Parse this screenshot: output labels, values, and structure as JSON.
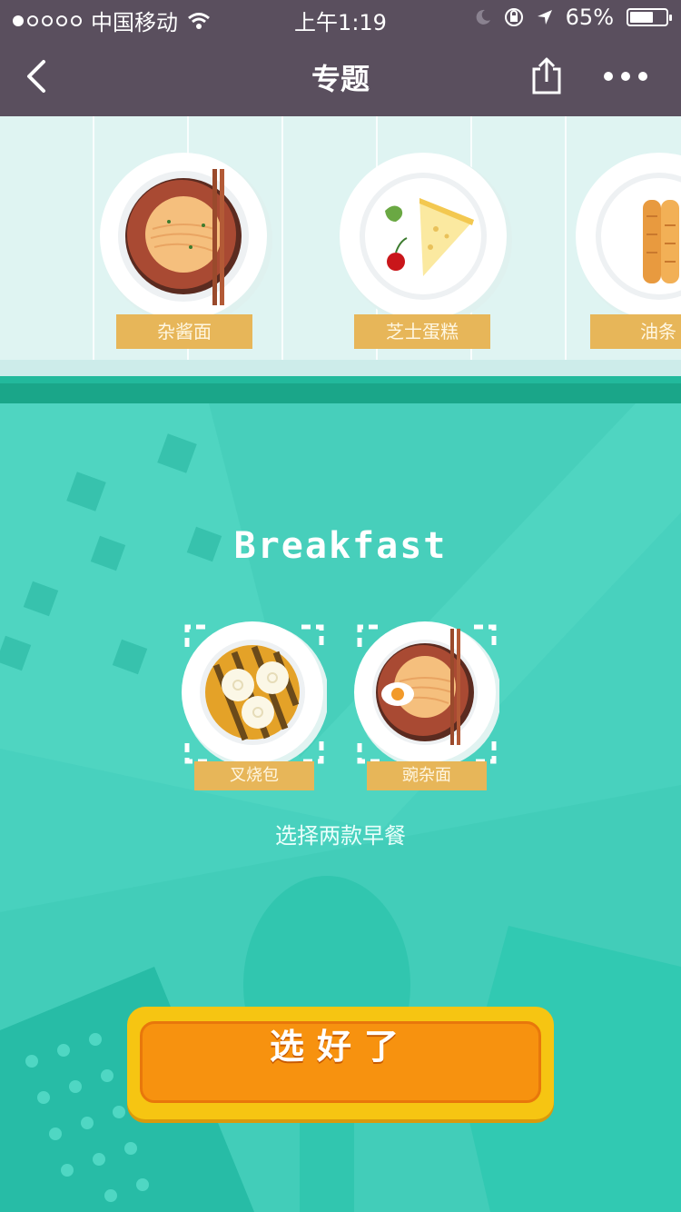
{
  "status_bar": {
    "carrier": "中国移动",
    "time": "上午1:19",
    "battery": "65%",
    "battery_level": 0.65
  },
  "nav": {
    "title": "专题",
    "back_icon": "chevron-left-icon",
    "share_icon": "share-icon",
    "more_icon": "more-dots-icon"
  },
  "carousel": {
    "items": [
      {
        "label": "杂酱面",
        "icon": "zajiang-noodle-plate"
      },
      {
        "label": "芝士蛋糕",
        "icon": "cheesecake-plate"
      },
      {
        "label": "油条",
        "icon": "youtiao-plate"
      }
    ]
  },
  "main": {
    "headline": "Breakfast",
    "selected": [
      {
        "label": "叉烧包",
        "icon": "char-siu-bao-plate"
      },
      {
        "label": "豌杂面",
        "icon": "wanza-noodle-plate"
      }
    ],
    "hint": "选择两款早餐",
    "confirm_label": "选好了"
  },
  "colors": {
    "nav_bg": "#5a4f5e",
    "teal": "#48d1be",
    "ribbon": "#e7b659",
    "button_orange": "#f7920f",
    "button_yellow": "#f6c512"
  }
}
